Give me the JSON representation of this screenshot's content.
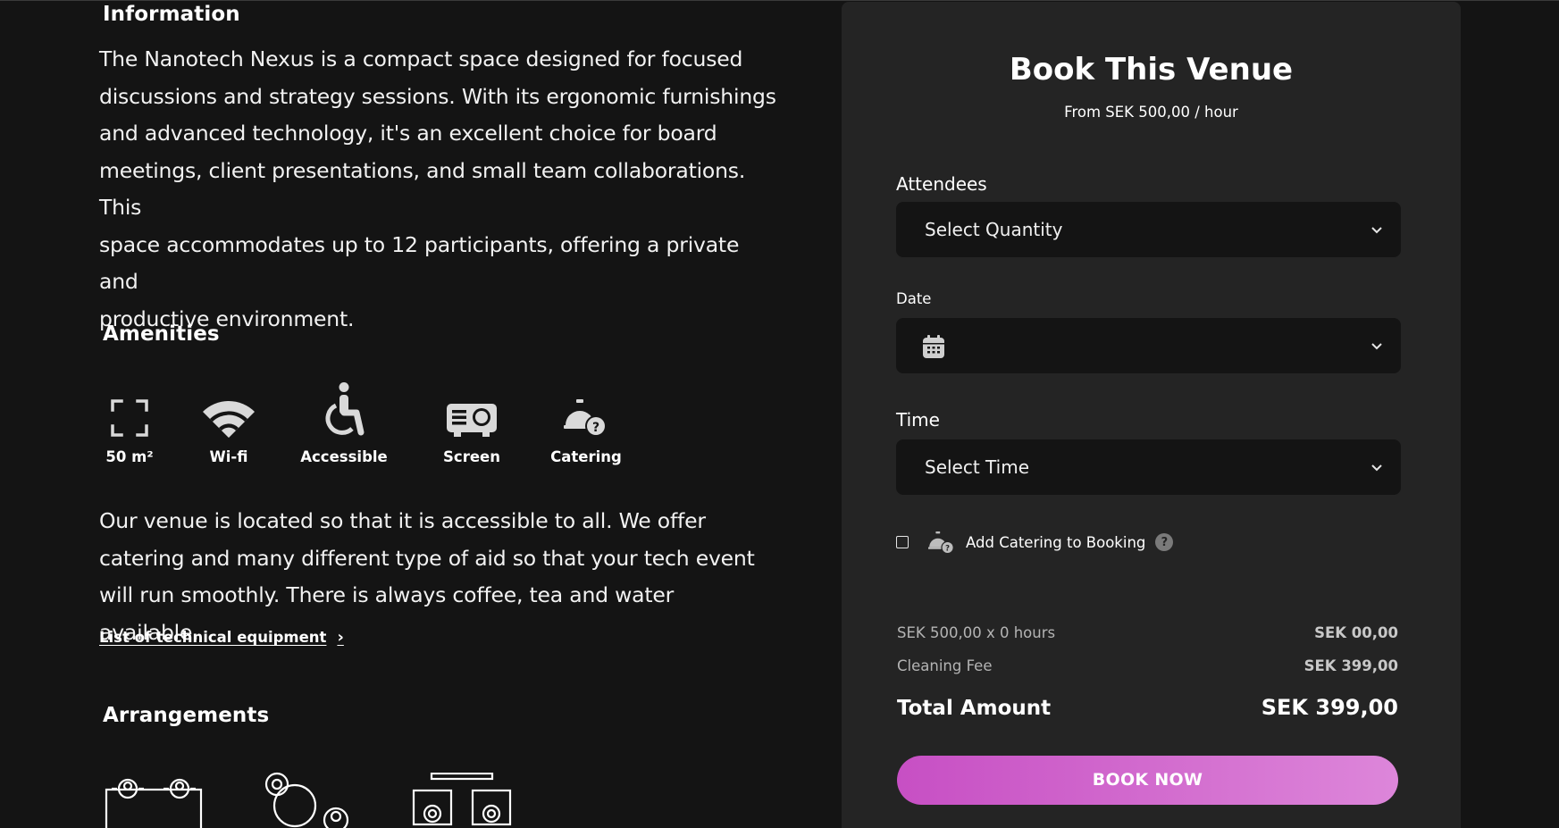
{
  "info": {
    "heading": "Information",
    "lines": [
      "The Nanotech Nexus is a compact space designed for focused",
      "discussions and strategy sessions. With its ergonomic furnishings",
      "and advanced technology, it's an excellent choice for board",
      "meetings, client presentations, and small team collaborations. This",
      "space accommodates up to 12 participants, offering a private and",
      "productive environment."
    ]
  },
  "amenities": {
    "heading": "Amenities",
    "items": [
      {
        "label": "50 m²",
        "icon": "area-icon"
      },
      {
        "label": "Wi-fi",
        "icon": "wifi-icon"
      },
      {
        "label": "Accessible",
        "icon": "wheelchair-icon"
      },
      {
        "label": "Screen",
        "icon": "projector-icon"
      },
      {
        "label": "Catering",
        "icon": "catering-icon"
      }
    ],
    "lines": [
      "Our venue is located so that it is accessible to all. We offer",
      "catering and many different type of aid so that your tech event",
      "will run smoothly. There is always coffee, tea and water available."
    ],
    "link": "List of technical equipment"
  },
  "arrangements": {
    "heading": "Arrangements"
  },
  "booking": {
    "title": "Book This Venue",
    "subtitle": "From SEK 500,00 / hour",
    "attendees_label": "Attendees",
    "attendees_value": "Select Quantity",
    "date_label": "Date",
    "time_label": "Time",
    "time_value": "Select Time",
    "catering_label": "Add Catering to Booking",
    "help_symbol": "?",
    "rate_line": "SEK 500,00 x 0 hours",
    "rate_amount": "SEK 00,00",
    "cleaning_label": "Cleaning Fee",
    "cleaning_amount": "SEK 399,00",
    "total_label": "Total Amount",
    "total_amount": "SEK 399,00",
    "button": "BOOK NOW"
  },
  "colors": {
    "background": "#141414",
    "panel": "#242424",
    "accent": "#d06acc"
  }
}
